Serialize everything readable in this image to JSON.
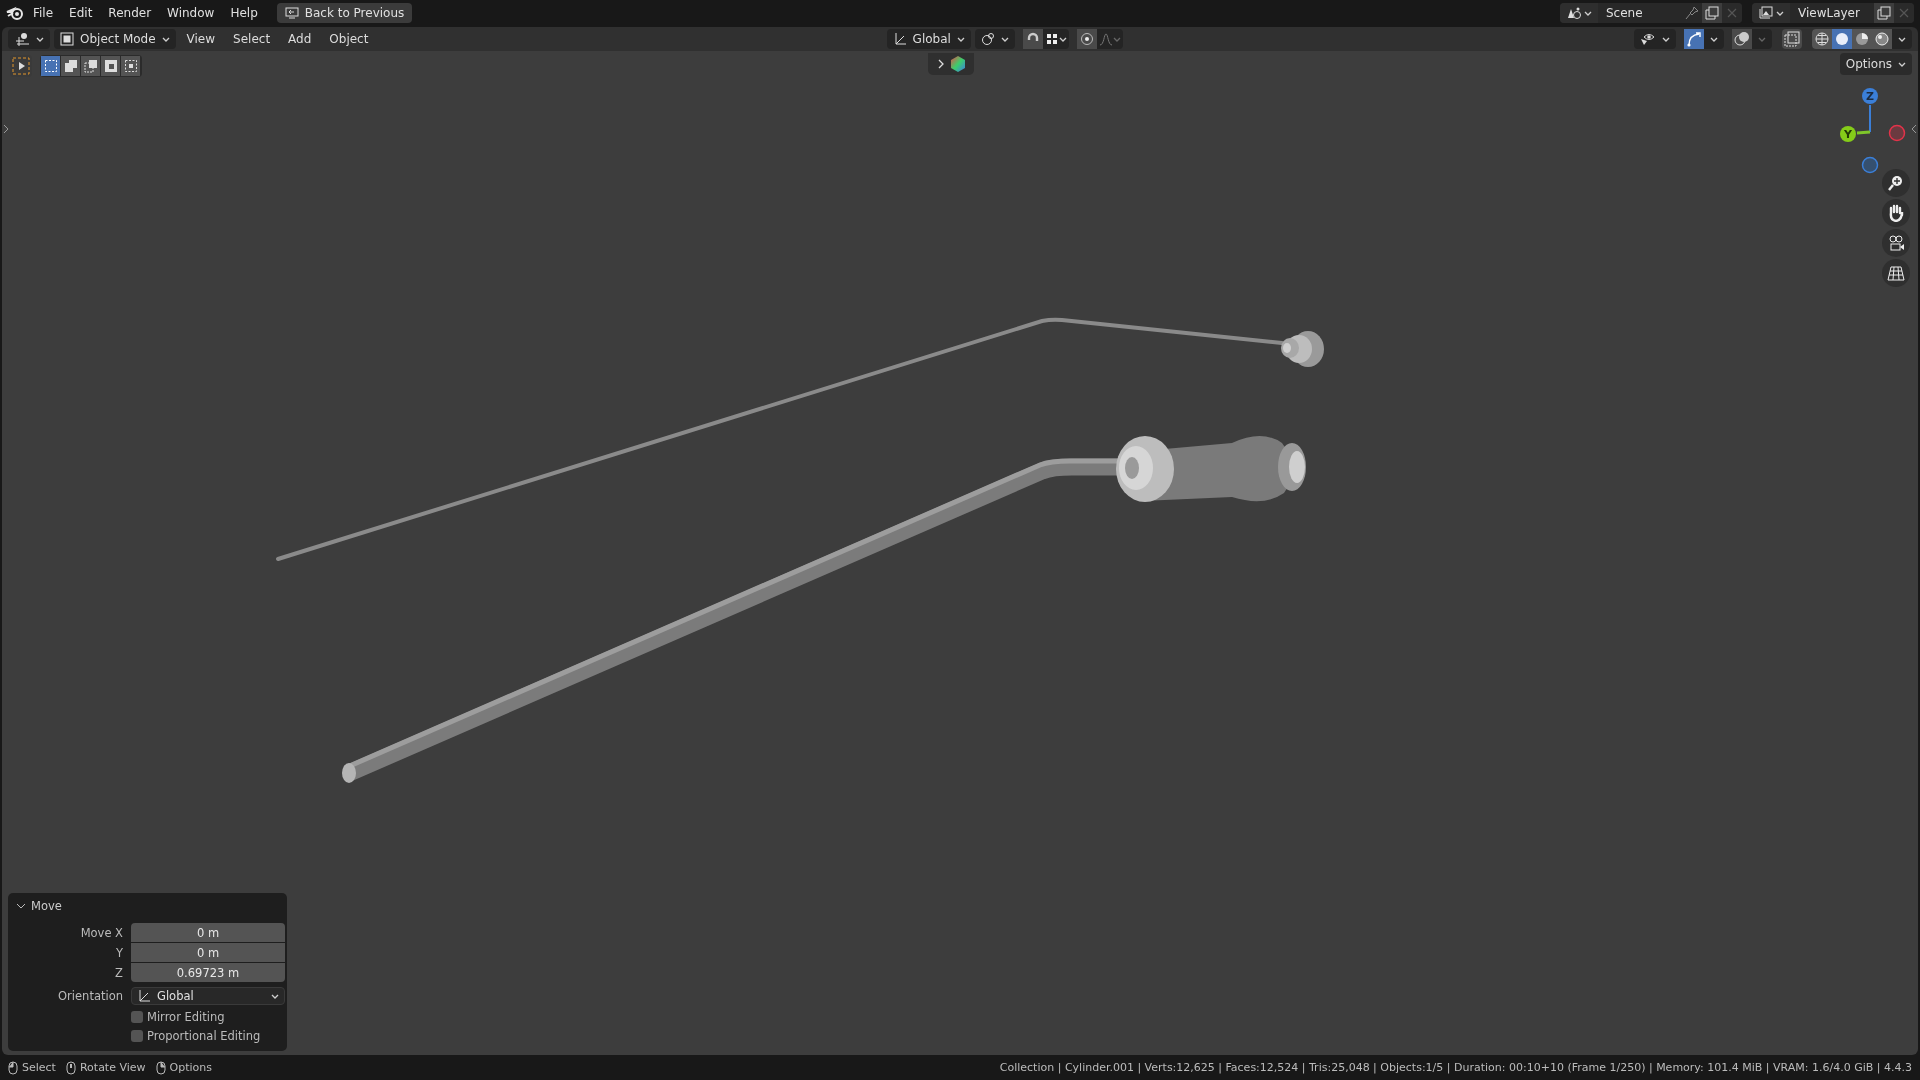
{
  "menu_bar": {
    "items": [
      "File",
      "Edit",
      "Render",
      "Window",
      "Help"
    ],
    "back_button": "Back to Previous"
  },
  "scene_selector": {
    "name": "Scene"
  },
  "view_layer_selector": {
    "name": "ViewLayer"
  },
  "header": {
    "mode": "Object Mode",
    "menus": [
      "View",
      "Select",
      "Add",
      "Object"
    ],
    "orientation": "Global",
    "snapping": {
      "on": false
    },
    "proportional_editing": {
      "on": false
    },
    "gizmos": {
      "on": true
    },
    "shading": [
      {
        "kind": "wireframe",
        "selected": false
      },
      {
        "kind": "solid",
        "selected": true
      },
      {
        "kind": "material",
        "selected": false
      },
      {
        "kind": "rendered",
        "selected": false
      }
    ]
  },
  "tool_settings": {
    "select_modes": [
      {
        "kind": "new",
        "selected": true
      },
      {
        "kind": "extend",
        "selected": false
      },
      {
        "kind": "subtract",
        "selected": false
      },
      {
        "kind": "difference",
        "selected": false
      },
      {
        "kind": "intersect",
        "selected": false
      }
    ],
    "options_button": "Options"
  },
  "asset_shelf": {
    "expanded": false
  },
  "gizmo": {
    "z_label": "Z",
    "y_label": "Y"
  },
  "operator_panel": {
    "title": "Move",
    "expanded": true,
    "fields": [
      {
        "label": "Move X",
        "value": "0 m"
      },
      {
        "label": "Y",
        "value": "0 m"
      },
      {
        "label": "Z",
        "value": "0.69723 m"
      }
    ],
    "orientation": {
      "label": "Orientation",
      "value": "Global"
    },
    "checkboxes": [
      {
        "label": "Mirror Editing",
        "checked": false
      },
      {
        "label": "Proportional Editing",
        "checked": false
      }
    ]
  },
  "status_bar": {
    "hints": [
      {
        "label": "Select"
      },
      {
        "label": "Rotate View"
      },
      {
        "label": "Options"
      }
    ],
    "stats": "Collection | Cylinder.001 | Verts:12,625 | Faces:12,524 | Tris:25,048 | Objects:1/5 | Duration: 00:10+10 (Frame 1/250) | Memory: 101.4 MiB | VRAM: 1.6/4.0 GiB | 4.4.3"
  }
}
